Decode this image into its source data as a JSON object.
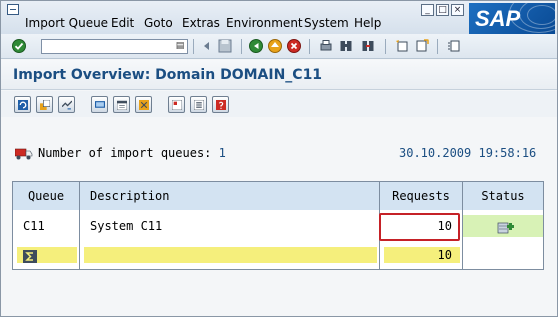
{
  "menu": {
    "items": [
      "Import Queue",
      "Edit",
      "Goto",
      "Extras",
      "Environment",
      "System",
      "Help"
    ]
  },
  "window": {
    "title": "Import Overview: Domain DOMAIN_C11",
    "logo": "SAP"
  },
  "toolbar": {
    "command_value": ""
  },
  "info": {
    "label": "Number of import queues:",
    "count": "1",
    "datetime": "30.10.2009 19:58:16"
  },
  "table": {
    "columns": [
      "Queue",
      "Description",
      "Requests",
      "Status"
    ],
    "rows": [
      {
        "queue": "C11",
        "description": "System C11",
        "requests": "10"
      }
    ],
    "total": {
      "requests": "10"
    }
  },
  "colors": {
    "title": "#1b4e82",
    "header": "#d3e3f2",
    "total_row": "#f5ef7c",
    "status_cell": "#d8f2b6",
    "highlight": "#c52127"
  }
}
